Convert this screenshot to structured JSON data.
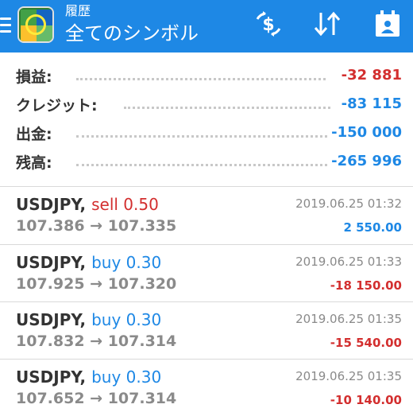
{
  "header": {
    "title_small": "履歴",
    "title_large": "全てのシンボル",
    "icons": [
      "menu-icon",
      "app-logo",
      "currency-exchange-icon",
      "sort-icon",
      "calendar-icon"
    ]
  },
  "summary": [
    {
      "label": "損益:",
      "value": "-32 881",
      "color": "#d32f2f"
    },
    {
      "label": "クレジット:",
      "value": "-83 115",
      "color": "#1e88e5"
    },
    {
      "label": "出金:",
      "value": "-150 000",
      "color": "#1e88e5"
    },
    {
      "label": "残高:",
      "value": "-265 996",
      "color": "#1e88e5"
    }
  ],
  "deals": [
    {
      "symbol": "USDJPY,",
      "type": "sell 0.50",
      "prices": "107.386 → 107.335",
      "time": "2019.06.25 01:32",
      "profit": "2 550.00"
    },
    {
      "symbol": "USDJPY,",
      "type": "buy 0.30",
      "prices": "107.925 → 107.320",
      "time": "2019.06.25 01:33",
      "profit": "-18 150.00"
    },
    {
      "symbol": "USDJPY,",
      "type": "buy 0.30",
      "prices": "107.832 → 107.314",
      "time": "2019.06.25 01:35",
      "profit": "-15 540.00"
    },
    {
      "symbol": "USDJPY,",
      "type": "buy 0.30",
      "prices": "107.652 → 107.314",
      "time": "2019.06.25 01:35",
      "profit": "-10 140.00"
    }
  ],
  "colors": {
    "appbar": "#1e88e5",
    "negative_red": "#d32f2f",
    "accent_blue": "#1e88e5",
    "secondary_gray": "#8a8a8a"
  }
}
